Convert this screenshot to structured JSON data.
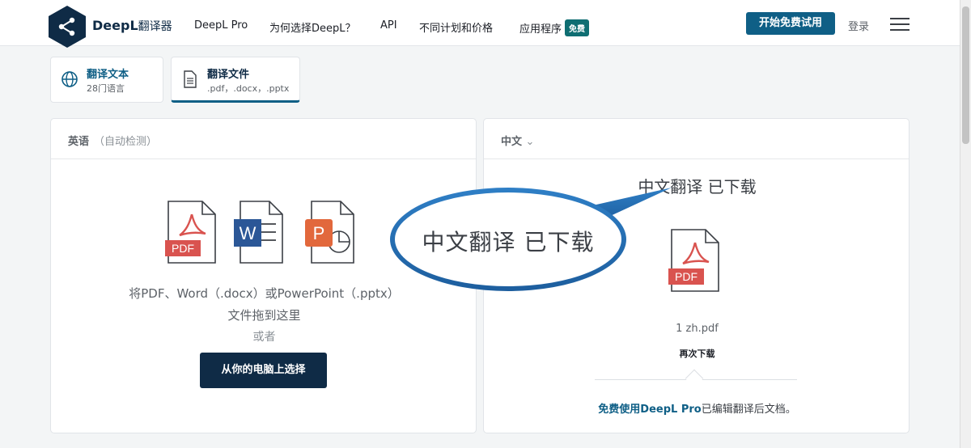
{
  "nav": {
    "brand": "DeepL",
    "brand_sub": "翻译器",
    "items": [
      "DeepL Pro",
      "为何选择DeepL？",
      "API",
      "不同计划和价格",
      "应用程序"
    ],
    "free_badge": "免费",
    "cta": "开始免费试用",
    "login": "登录"
  },
  "tabs": [
    {
      "label": "翻译文本",
      "sub": "28门语言",
      "icon": "globe-icon"
    },
    {
      "label": "翻译文件",
      "sub": ".pdf，.docx，.pptx",
      "icon": "document-icon"
    }
  ],
  "source": {
    "lang": "英语",
    "detect": "（自动检测）",
    "drop_line1": "将PDF、Word（.docx）或PowerPoint（.pptx）",
    "drop_line2": "文件拖到这里",
    "or": "或者",
    "choose_button": "从你的电脑上选择",
    "icons": [
      "pdf-icon",
      "word-icon",
      "powerpoint-icon"
    ]
  },
  "target": {
    "lang": "中文",
    "title": "中文翻译 已下载",
    "file_name": "1 zh.pdf",
    "redownload": "再次下载",
    "promo_link": "免费使用DeepL Pro",
    "promo_rest": "已编辑翻译后文档。"
  },
  "callout": {
    "text": "中文翻译 已下载"
  },
  "colors": {
    "brand_dark": "#0f2b46",
    "accent_blue": "#0f5f86",
    "badge_teal": "#0f6e72",
    "pdf_red": "#d9534f",
    "word_blue": "#2b5797",
    "ppt_orange": "#e2683c"
  }
}
